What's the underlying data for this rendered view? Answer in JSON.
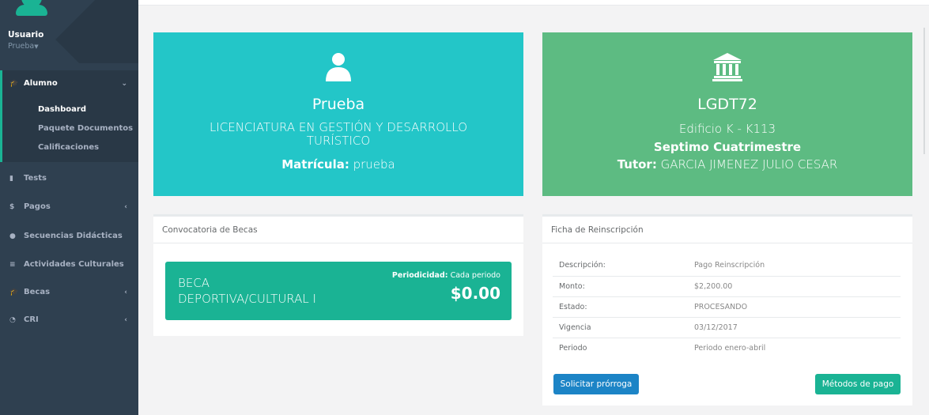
{
  "sidebar": {
    "user_name": "Usuario",
    "user_role": "Prueba",
    "menu": {
      "alumno": "Alumno",
      "dashboard": "Dashboard",
      "paquete": "Paquete Documentos",
      "calificaciones": "Calificaciones",
      "tests": "Tests",
      "pagos": "Pagos",
      "secuencias": "Secuencias Didácticas",
      "actividades": "Actividades Culturales",
      "becas": "Becas",
      "cri": "CRI"
    }
  },
  "student_card": {
    "name": "Prueba",
    "program": "LICENCIATURA EN GESTIÓN Y DESARROLLO TURÍSTICO",
    "matricula_label": "Matrícula:",
    "matricula_value": "prueba",
    "color": "#23c6c8"
  },
  "group_card": {
    "group": "LGDT72",
    "classroom": "Edificio K - K113",
    "term": "Septimo Cuatrimestre",
    "tutor_label": "Tutor:",
    "tutor_value": "GARCIA JIMENEZ JULIO CESAR",
    "color": "#5dbb82"
  },
  "becas_panel": {
    "title": "Convocatoria de Becas",
    "beca_name_line1": "BECA",
    "beca_name_line2": "DEPORTIVA/CULTURAL I",
    "periodicity_label": "Periodicidad:",
    "periodicity_value": "Cada periodo",
    "amount": "$0.00"
  },
  "ficha_panel": {
    "title": "Ficha de Reinscripción",
    "rows": [
      {
        "label": "Descripción:",
        "value": "Pago Reinscripción"
      },
      {
        "label": "Monto:",
        "value": "$2,200.00"
      },
      {
        "label": "Estado:",
        "value": "PROCESANDO"
      },
      {
        "label": "Vigencia",
        "value": "03/12/2017"
      },
      {
        "label": "Periodo",
        "value": "Periodo enero-abril"
      }
    ],
    "btn_prorroga": "Solicitar prórroga",
    "btn_metodos": "Métodos de pago"
  }
}
